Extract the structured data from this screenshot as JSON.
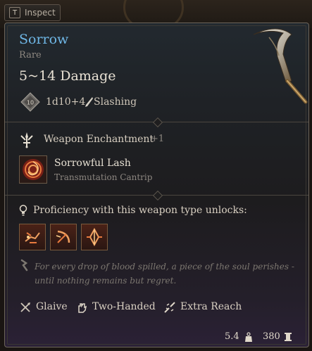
{
  "inspect_tab": {
    "key": "T",
    "label": "Inspect"
  },
  "item": {
    "name": "Sorrow",
    "rarity": "Rare",
    "damage": "5~14 Damage",
    "dice": "1d10+4",
    "damage_type": "Slashing",
    "die_face": "10"
  },
  "enchantment": {
    "label": "Weapon Enchantment",
    "bonus": "+1"
  },
  "spell": {
    "name": "Sorrowful Lash",
    "school": "Transmutation Cantrip"
  },
  "proficiency": {
    "label": "Proficiency with this weapon type unlocks:",
    "actions": [
      "action-icon-1",
      "action-icon-2",
      "action-icon-3"
    ]
  },
  "flavor_text": "For every drop of blood spilled, a piece of the soul perishes - until nothing remains but regret.",
  "properties": [
    "Glaive",
    "Two-Handed",
    "Extra Reach"
  ],
  "footer": {
    "weight": "5.4",
    "price": "380"
  },
  "colors": {
    "name": "#6fb7e6",
    "rarity": "#8d8780",
    "accent_red": "#c9452c"
  }
}
